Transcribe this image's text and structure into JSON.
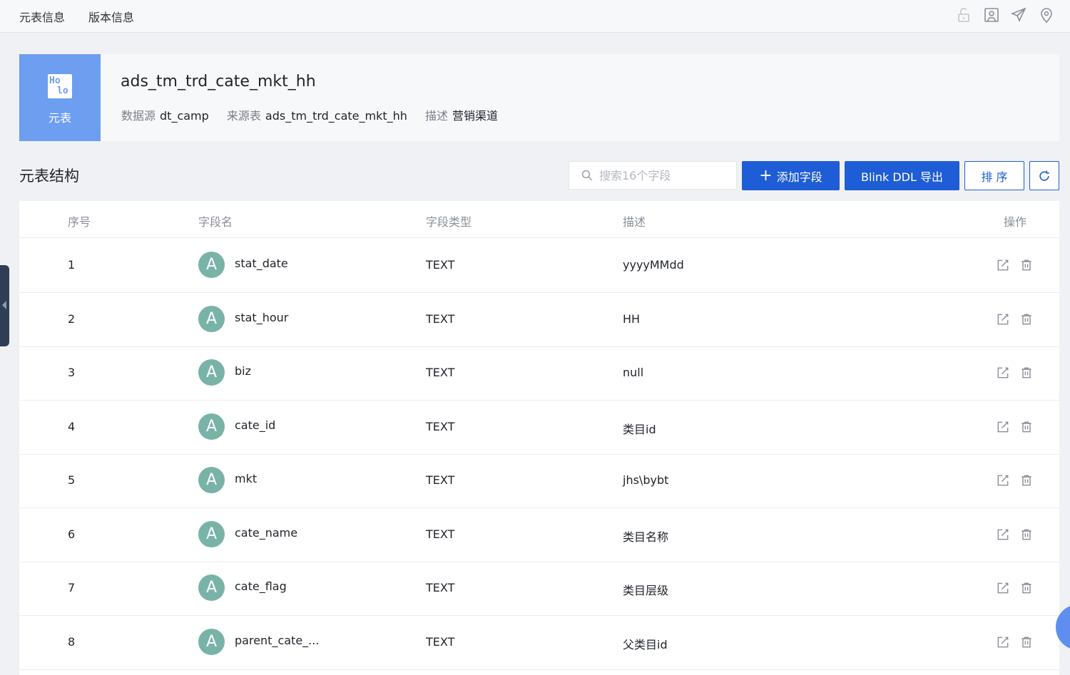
{
  "topbar": {
    "tabs": [
      "元表信息",
      "版本信息"
    ],
    "icons": [
      "lock-icon",
      "monitor-icon",
      "send-icon",
      "location-icon"
    ]
  },
  "header": {
    "logo_text": "Ho lo",
    "logo_label": "元表",
    "title": "ads_tm_trd_cate_mkt_hh",
    "meta": [
      {
        "key": "数据源",
        "value": "dt_camp"
      },
      {
        "key": "来源表",
        "value": "ads_tm_trd_cate_mkt_hh"
      },
      {
        "key": "描述",
        "value": "营销渠道"
      }
    ]
  },
  "section": {
    "title": "元表结构",
    "search_placeholder": "搜索16个字段",
    "add_label": "添加字段",
    "export_label": "Blink DDL 导出",
    "sort_label": "排 序"
  },
  "table": {
    "columns": [
      "序号",
      "字段名",
      "字段类型",
      "描述",
      "操作"
    ],
    "rows": [
      {
        "no": "1",
        "avatar": "A",
        "name": "stat_date",
        "type": "TEXT",
        "desc": "yyyyMMdd"
      },
      {
        "no": "2",
        "avatar": "A",
        "name": "stat_hour",
        "type": "TEXT",
        "desc": "HH"
      },
      {
        "no": "3",
        "avatar": "A",
        "name": "biz",
        "type": "TEXT",
        "desc": "null"
      },
      {
        "no": "4",
        "avatar": "A",
        "name": "cate_id",
        "type": "TEXT",
        "desc": "类目id"
      },
      {
        "no": "5",
        "avatar": "A",
        "name": "mkt",
        "type": "TEXT",
        "desc": "jhs\\bybt"
      },
      {
        "no": "6",
        "avatar": "A",
        "name": "cate_name",
        "type": "TEXT",
        "desc": "类目名称"
      },
      {
        "no": "7",
        "avatar": "A",
        "name": "cate_flag",
        "type": "TEXT",
        "desc": "类目层级"
      },
      {
        "no": "8",
        "avatar": "A",
        "name": "parent_cate_...",
        "type": "TEXT",
        "desc": "父类目id"
      }
    ]
  },
  "colors": {
    "primary": "#1f5dd6",
    "logo_bg": "#6d9ef0",
    "avatar_bg": "#79b3a8"
  }
}
